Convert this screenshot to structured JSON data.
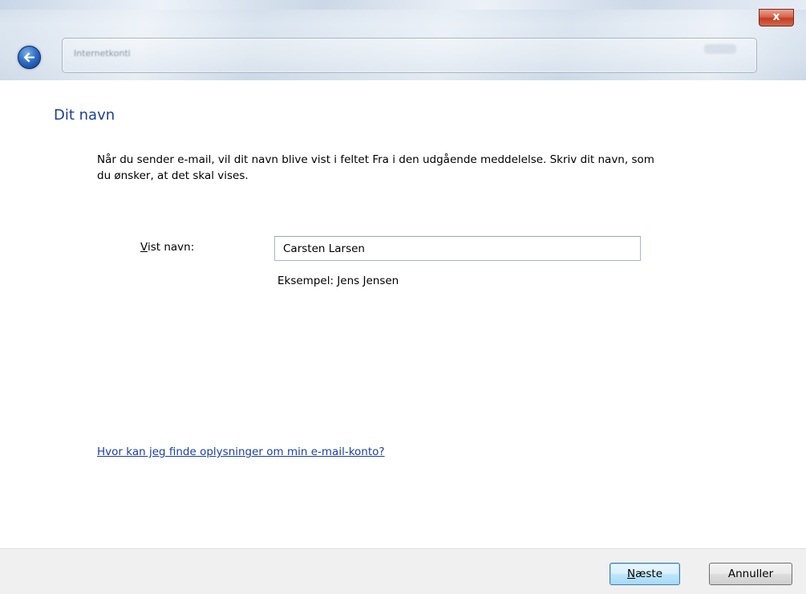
{
  "window": {
    "close_label": "x",
    "address_text": "Internetkonti"
  },
  "page": {
    "heading": "Dit navn",
    "description": "Når du sender e-mail, vil dit navn blive vist i feltet Fra i den udgående meddelelse. Skriv dit navn, som du ønsker, at det skal vises.",
    "field_label_accesskey": "V",
    "field_label_rest": "ist navn:",
    "name_value": "Carsten Larsen",
    "example": "Eksempel: Jens Jensen",
    "help_link": "Hvor kan jeg finde oplysninger om min e-mail-konto?"
  },
  "buttons": {
    "next_accesskey": "N",
    "next_rest": "æste",
    "cancel": "Annuller"
  }
}
